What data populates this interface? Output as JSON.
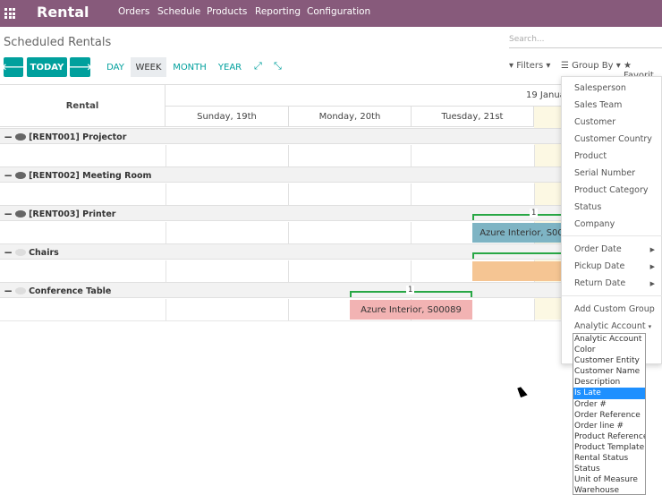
{
  "topbar": {
    "brand": "Rental",
    "menu": [
      "Orders",
      "Schedule",
      "Products",
      "Reporting",
      "Configuration"
    ]
  },
  "page": {
    "title": "Scheduled Rentals"
  },
  "search": {
    "placeholder": "Search..."
  },
  "toolbar": {
    "prev_icon": "🡐",
    "today": "TODAY",
    "next_icon": "🡒",
    "scales": [
      "DAY",
      "WEEK",
      "MONTH",
      "YEAR"
    ],
    "active_scale": "WEEK",
    "filters": "Filters",
    "group_by": "Group By",
    "favorites": "Favorit"
  },
  "gantt": {
    "left_header": "Rental",
    "month_header": "19 Janua",
    "days": [
      "Sunday, 19th",
      "Monday, 20th",
      "Tuesday, 21st"
    ],
    "groups": [
      {
        "label": "[RENT001] Projector"
      },
      {
        "label": "[RENT002] Meeting Room"
      },
      {
        "label": "[RENT003] Printer"
      },
      {
        "label": "Chairs"
      },
      {
        "label": "Conference Table"
      }
    ],
    "bars": [
      {
        "label": "Azure Interior, S00",
        "color": "#7eb4c4"
      },
      {
        "label": "",
        "color": "#f5c593"
      },
      {
        "label": "Azure Interior, S00089",
        "color": "#f2b3b3"
      }
    ],
    "consolidation": [
      "1",
      "1"
    ]
  },
  "groupby_menu": {
    "items": [
      "Salesperson",
      "Sales Team",
      "Customer",
      "Customer Country",
      "Product",
      "Serial Number",
      "Product Category",
      "Status",
      "Company"
    ],
    "date_items": [
      "Order Date",
      "Pickup Date",
      "Return Date"
    ],
    "add_custom": "Add Custom Group",
    "select_value": "Analytic Account"
  },
  "listbox": {
    "options": [
      "Analytic Account",
      "Color",
      "Customer Entity",
      "Customer Name",
      "Description",
      "Is Late",
      "Order #",
      "Order Reference",
      "Order line #",
      "Product Reference",
      "Product Template",
      "Rental Status",
      "Status",
      "Unit of Measure",
      "Warehouse"
    ],
    "selected": "Is Late"
  },
  "colors": {
    "topbar": "#875a7b",
    "accent": "#00a09d"
  }
}
